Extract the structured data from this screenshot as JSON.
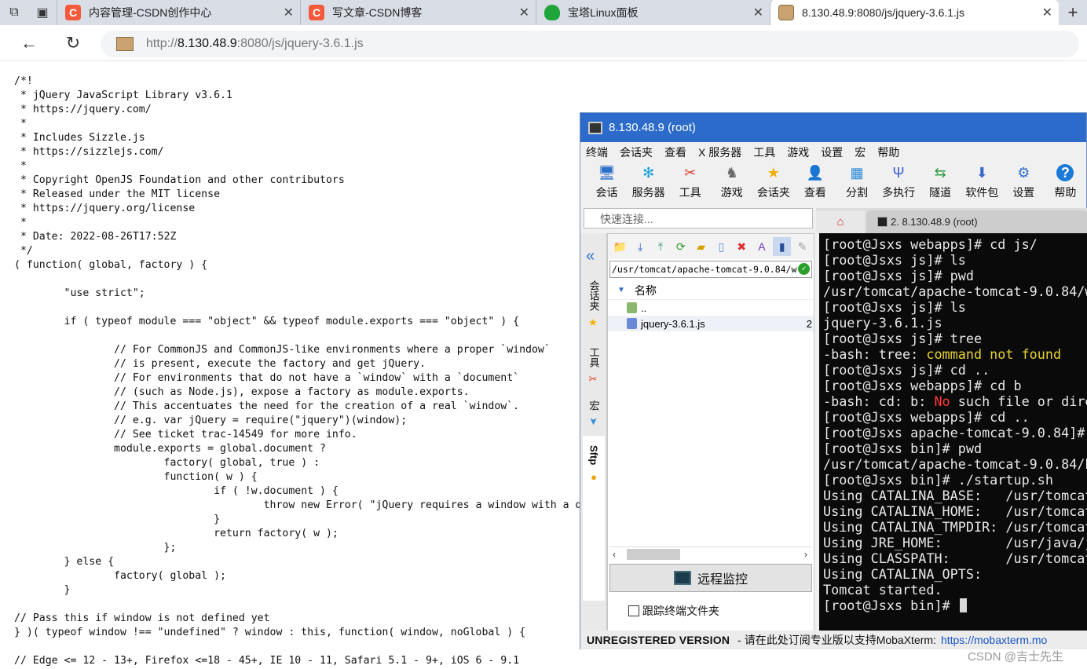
{
  "browser": {
    "tabs": [
      {
        "title": "内容管理-CSDN创作中心",
        "favicon": "csdn-icon",
        "active": false
      },
      {
        "title": "写文章-CSDN博客",
        "favicon": "csdn-icon",
        "active": false
      },
      {
        "title": "宝塔Linux面板",
        "favicon": "bt-shield-icon",
        "active": false
      },
      {
        "title": "8.130.48.9:8080/js/jquery-3.6.1.js",
        "favicon": "tomcat-icon",
        "active": true
      }
    ],
    "url_prefix": "http://",
    "url_host": "8.130.48.9",
    "url_rest": ":8080/js/jquery-3.6.1.js",
    "colors": {
      "csdn": "#f55a3c",
      "bt": "#20a53a",
      "tabbar": "#d9dde6"
    }
  },
  "code_lines": [
    "/*!",
    " * jQuery JavaScript Library v3.6.1",
    " * https://jquery.com/",
    " *",
    " * Includes Sizzle.js",
    " * https://sizzlejs.com/",
    " *",
    " * Copyright OpenJS Foundation and other contributors",
    " * Released under the MIT license",
    " * https://jquery.org/license",
    " *",
    " * Date: 2022-08-26T17:52Z",
    " */",
    "( function( global, factory ) {",
    "",
    "        \"use strict\";",
    "",
    "        if ( typeof module === \"object\" && typeof module.exports === \"object\" ) {",
    "",
    "                // For CommonJS and CommonJS-like environments where a proper `window`",
    "                // is present, execute the factory and get jQuery.",
    "                // For environments that do not have a `window` with a `document`",
    "                // (such as Node.js), expose a factory as module.exports.",
    "                // This accentuates the need for the creation of a real `window`.",
    "                // e.g. var jQuery = require(\"jquery\")(window);",
    "                // See ticket trac-14549 for more info.",
    "                module.exports = global.document ?",
    "                        factory( global, true ) :",
    "                        function( w ) {",
    "                                if ( !w.document ) {",
    "                                        throw new Error( \"jQuery requires a window with a document\" );",
    "                                }",
    "                                return factory( w );",
    "                        };",
    "        } else {",
    "                factory( global );",
    "        }",
    "",
    "// Pass this if window is not defined yet",
    "} )( typeof window !== \"undefined\" ? window : this, function( window, noGlobal ) {",
    "",
    "// Edge <= 12 - 13+, Firefox <=18 - 45+, IE 10 - 11, Safari 5.1 - 9+, iOS 6 - 9.1"
  ],
  "moba": {
    "title": "8.130.48.9 (root)",
    "menu": [
      "终端",
      "会话夹",
      "查看",
      "X 服务器",
      "工具",
      "游戏",
      "设置",
      "宏",
      "帮助"
    ],
    "tools": [
      {
        "label": "会话",
        "icon": "session-icon"
      },
      {
        "label": "服务器",
        "icon": "servers-icon"
      },
      {
        "label": "工具",
        "icon": "tools-icon"
      },
      {
        "label": "游戏",
        "icon": "games-icon"
      },
      {
        "label": "会话夹",
        "icon": "star-icon"
      },
      {
        "label": "查看",
        "icon": "view-icon"
      },
      {
        "label": "分割",
        "icon": "split-icon"
      },
      {
        "label": "多执行",
        "icon": "multiexec-icon"
      },
      {
        "label": "隧道",
        "icon": "tunnel-icon"
      },
      {
        "label": "软件包",
        "icon": "packages-icon"
      },
      {
        "label": "设置",
        "icon": "settings-icon"
      },
      {
        "label": "帮助",
        "icon": "help-icon"
      }
    ],
    "quick_connect_placeholder": "快速连接...",
    "side_tabs": [
      "会话夹",
      "工具",
      "宏",
      "Sftp"
    ],
    "sftp_path": "/usr/tomcat/apache-tomcat-9.0.84/w",
    "file_header": "名称",
    "files": [
      {
        "name": "..",
        "type": "parent"
      },
      {
        "name": "jquery-3.6.1.js",
        "type": "js",
        "size_hint": "2"
      }
    ],
    "remote_monitor": "远程监控",
    "follow_terminal": "跟踪终端文件夹",
    "term_tab": "2. 8.130.48.9 (root)",
    "terminal": [
      [
        {
          "t": "[root@Jsxs webapps]# cd js/"
        }
      ],
      [
        {
          "t": "[root@Jsxs js]# ls"
        }
      ],
      [
        {
          "t": "[root@Jsxs js]# pwd"
        }
      ],
      [
        {
          "t": "/usr/tomcat/apache-tomcat-9.0.84/w"
        }
      ],
      [
        {
          "t": "[root@Jsxs js]# ls"
        }
      ],
      [
        {
          "t": "jquery-3.6.1.js"
        }
      ],
      [
        {
          "t": "[root@Jsxs js]# tree"
        }
      ],
      [
        {
          "t": "-bash: tree: "
        },
        {
          "t": "command not found",
          "c": "#e8d233"
        }
      ],
      [
        {
          "t": "[root@Jsxs js]# cd .."
        }
      ],
      [
        {
          "t": "[root@Jsxs webapps]# cd b"
        }
      ],
      [
        {
          "t": "-bash: cd: b: "
        },
        {
          "t": "No",
          "c": "#ff3b3b"
        },
        {
          "t": " such file or dire"
        }
      ],
      [
        {
          "t": "[root@Jsxs webapps]# cd .."
        }
      ],
      [
        {
          "t": "[root@Jsxs apache-tomcat-9.0.84]# "
        }
      ],
      [
        {
          "t": "[root@Jsxs bin]# pwd"
        }
      ],
      [
        {
          "t": "/usr/tomcat/apache-tomcat-9.0.84/b"
        }
      ],
      [
        {
          "t": "[root@Jsxs bin]# ./startup.sh"
        }
      ],
      [
        {
          "t": "Using CATALINA_BASE:   /usr/tomcat"
        }
      ],
      [
        {
          "t": "Using CATALINA_HOME:   /usr/tomcat"
        }
      ],
      [
        {
          "t": "Using CATALINA_TMPDIR: /usr/tomcat"
        }
      ],
      [
        {
          "t": "Using JRE_HOME:        /usr/java/j"
        }
      ],
      [
        {
          "t": "Using CLASSPATH:       /usr/tomcat"
        }
      ],
      [
        {
          "t": "Using CATALINA_OPTS:"
        }
      ],
      [
        {
          "t": "Tomcat started."
        }
      ],
      [
        {
          "t": "[root@Jsxs bin]# "
        }
      ]
    ],
    "status_bold": "UNREGISTERED VERSION",
    "status_text": "-  请在此处订阅专业版以支持MobaXterm:",
    "status_link": "https://mobaxterm.mo"
  },
  "watermark": "CSDN @吉士先生"
}
